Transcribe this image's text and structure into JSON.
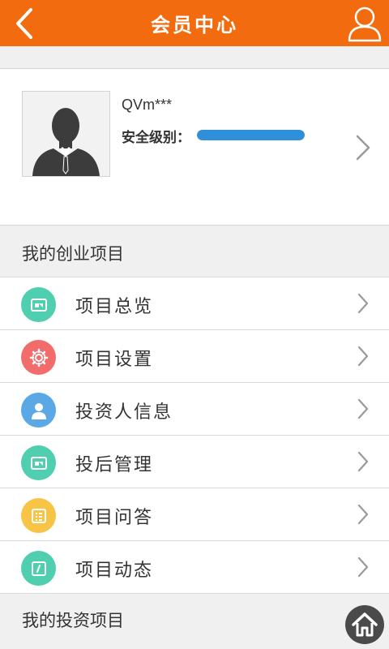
{
  "header": {
    "title": "会员中心",
    "back_icon": "chevron-left-icon",
    "user_icon": "user-icon",
    "background": "#f26b0e"
  },
  "profile": {
    "username": "QVm***",
    "security_label": "安全级别：",
    "security_level": 1.0,
    "security_color": "#2f8fd8"
  },
  "sections": {
    "startup_projects": "我的创业项目",
    "invest_projects": "我的投资项目"
  },
  "menu": [
    {
      "label": "项目总览",
      "icon": "project-overview-icon",
      "color": "#4fcfb0"
    },
    {
      "label": "项目设置",
      "icon": "gear-icon",
      "color": "#f26c6c"
    },
    {
      "label": "投资人信息",
      "icon": "investor-icon",
      "color": "#5aa9e6"
    },
    {
      "label": "投后管理",
      "icon": "post-investment-icon",
      "color": "#4fcfb0"
    },
    {
      "label": "项目问答",
      "icon": "qa-icon",
      "color": "#f7c446"
    },
    {
      "label": "项目动态",
      "icon": "project-news-icon",
      "color": "#4fcfb0"
    }
  ],
  "floating": {
    "home_icon": "home-icon"
  }
}
